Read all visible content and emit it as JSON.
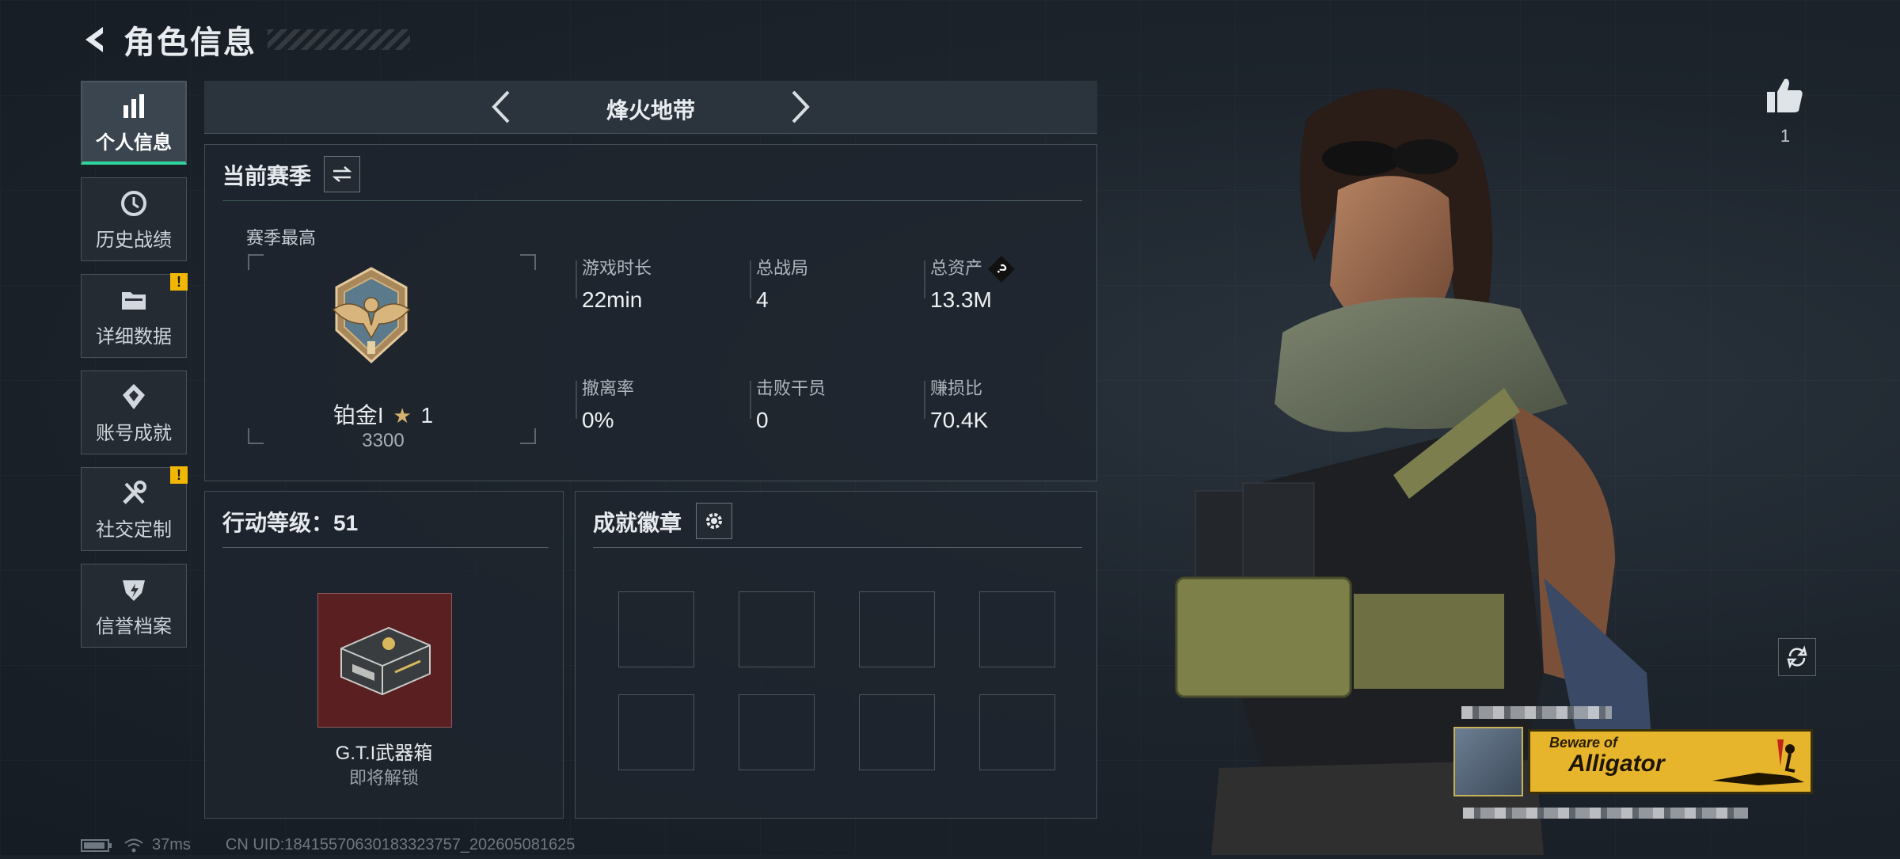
{
  "header": {
    "title": "角色信息"
  },
  "sidebar": {
    "items": [
      {
        "label": "个人信息",
        "icon": "bar-chart-icon",
        "active": true,
        "warning": false
      },
      {
        "label": "历史战绩",
        "icon": "history-icon",
        "active": false,
        "warning": false
      },
      {
        "label": "详细数据",
        "icon": "folder-icon",
        "active": false,
        "warning": true
      },
      {
        "label": "账号成就",
        "icon": "achievement-icon",
        "active": false,
        "warning": false
      },
      {
        "label": "社交定制",
        "icon": "tools-icon",
        "active": false,
        "warning": true
      },
      {
        "label": "信誉档案",
        "icon": "shield-icon",
        "active": false,
        "warning": false
      }
    ],
    "warning_glyph": "!"
  },
  "map": {
    "name": "烽火地带"
  },
  "season": {
    "title": "当前赛季",
    "best_label": "赛季最高",
    "rank_name": "铂金I",
    "rank_stars": "1",
    "rank_score": "3300",
    "stats": [
      {
        "label": "游戏时长",
        "value": "22min"
      },
      {
        "label": "总战局",
        "value": "4"
      },
      {
        "label": "总资产",
        "value": "13.3M",
        "help": "?"
      },
      {
        "label": "撤离率",
        "value": "0%"
      },
      {
        "label": "击败干员",
        "value": "0"
      },
      {
        "label": "赚损比",
        "value": "70.4K"
      }
    ]
  },
  "level": {
    "title": "行动等级：51",
    "reward_name": "G.T.I武器箱",
    "reward_status": "即将解锁"
  },
  "badges": {
    "title": "成就徽章",
    "slots": 8
  },
  "like": {
    "count": "1"
  },
  "card": {
    "banner_small": "Beware of",
    "banner_big": "Alligator"
  },
  "footer": {
    "ping": "37ms",
    "uid": "CN UID:18415570630183323757_202605081625"
  },
  "colors": {
    "accent": "#2fd59c",
    "warning": "#f2b705",
    "reward_bg": "#5a1f20"
  }
}
